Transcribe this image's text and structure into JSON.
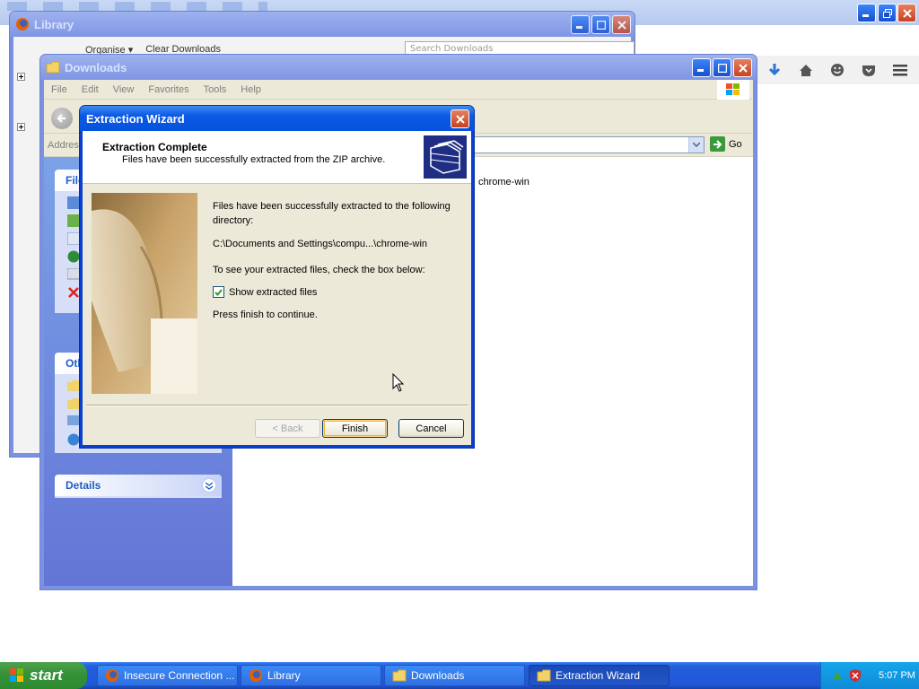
{
  "firefox": {
    "toolbar_icons": [
      "download-arrow-icon",
      "home-icon",
      "smiley-icon",
      "pocket-icon",
      "hamburger-menu-icon"
    ]
  },
  "library": {
    "title": "Library",
    "organise_label": "Organise ▾",
    "clear_downloads_label": "Clear Downloads",
    "search_placeholder": "Search Downloads"
  },
  "downloads_window": {
    "title": "Downloads",
    "menu": [
      "File",
      "Edit",
      "View",
      "Favorites",
      "Tools",
      "Help"
    ],
    "address_label": "Address",
    "go_label": "Go",
    "file_tasks_title": "File",
    "other_places_title": "Oth",
    "details_title": "Details",
    "file_item": "chrome-win"
  },
  "wizard": {
    "title": "Extraction Wizard",
    "header_title": "Extraction Complete",
    "header_subtitle": "Files have been successfully extracted from the ZIP archive.",
    "line1": "Files have been successfully extracted to the following directory:",
    "path": "C:\\Documents and Settings\\compu...\\chrome-win",
    "line2": "To see your extracted files, check the box below:",
    "checkbox_label": "Show extracted files",
    "checkbox_checked": true,
    "line3": "Press finish to continue.",
    "back_label": "< Back",
    "finish_label": "Finish",
    "cancel_label": "Cancel"
  },
  "taskbar": {
    "start_label": "start",
    "tasks": [
      {
        "label": "Insecure Connection ...",
        "icon": "firefox-icon"
      },
      {
        "label": "Library",
        "icon": "firefox-icon"
      },
      {
        "label": "Downloads",
        "icon": "folder-icon"
      },
      {
        "label": "Extraction Wizard",
        "icon": "folder-icon"
      }
    ],
    "clock": "5:07 PM"
  },
  "colors": {
    "xp_blue": "#0a58e4",
    "taskbar_blue": "#245edb",
    "start_green": "#37933a",
    "close_red": "#c8411f"
  }
}
